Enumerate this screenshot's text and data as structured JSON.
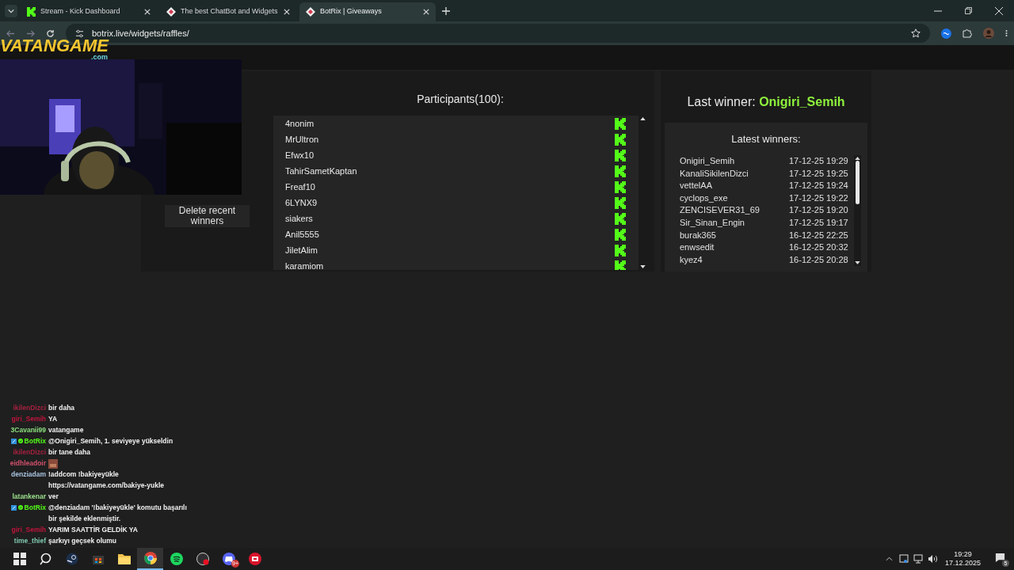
{
  "browser": {
    "tabs": [
      {
        "title": "Stream - Kick Dashboard",
        "kind": "kick",
        "selected": false
      },
      {
        "title": "The best ChatBot and Widgets",
        "kind": "botrix",
        "selected": false
      },
      {
        "title": "BotRix | Giveaways",
        "kind": "botrix",
        "selected": true
      }
    ],
    "address": "botrix.live/widgets/raffles/"
  },
  "overlay": {
    "logo": "VATANGAME",
    "logo_suffix": ".com"
  },
  "side_buttons": [
    "Delete recent winners"
  ],
  "participants": {
    "title": "Participants(100):",
    "names": [
      "4nonim",
      "MrUltron",
      "Efwx10",
      "TahirSametKaptan",
      "Freaf10",
      "6LYNX9",
      "siakers",
      "Anil5555",
      "JiletAlim",
      "karamiom"
    ]
  },
  "last_winner": {
    "label": "Last winner:",
    "name": "Onigiri_Semih"
  },
  "latest_winners": {
    "title": "Latest winners:",
    "rows": [
      {
        "name": "Onigiri_Semih",
        "time": "17-12-25 19:29"
      },
      {
        "name": "KanaliSikilenDizci",
        "time": "17-12-25 19:25"
      },
      {
        "name": "vettelAA",
        "time": "17-12-25 19:24"
      },
      {
        "name": "cyclops_exe",
        "time": "17-12-25 19:22"
      },
      {
        "name": "ZENCISEVER31_69",
        "time": "17-12-25 19:20"
      },
      {
        "name": "Sir_Sinan_Engin",
        "time": "17-12-25 19:17"
      },
      {
        "name": "burak365",
        "time": "16-12-25 22:25"
      },
      {
        "name": "enwsedit",
        "time": "16-12-25 20:32"
      },
      {
        "name": "kyez4",
        "time": "16-12-25 20:28"
      }
    ]
  },
  "chat": [
    {
      "kind": "user",
      "user": "ikilenDizci",
      "color": "#a3213f",
      "text": "bir daha"
    },
    {
      "kind": "user",
      "user": "giri_Semih",
      "color": "#c0143c",
      "text": "YA"
    },
    {
      "kind": "user",
      "user": "3Cavanii99",
      "color": "#8be07f",
      "text": "vatangame"
    },
    {
      "kind": "bot",
      "user": "BotRix",
      "color": "#53fc18",
      "text": "@Onigiri_Semih, 1. seviyeye yükseldin"
    },
    {
      "kind": "user",
      "user": "ikilenDizci",
      "color": "#a3213f",
      "text": "bir tane daha"
    },
    {
      "kind": "emote",
      "user": "eidhleadoir",
      "color": "#d2506c"
    },
    {
      "kind": "user",
      "user": "denziadam",
      "color": "#a9c4e0",
      "text": "!addcom !bakiyeyükle https://vatangame.com/bakiye-yukle"
    },
    {
      "kind": "user",
      "user": "latankenar",
      "color": "#9be08c",
      "text": "ver"
    },
    {
      "kind": "bot",
      "user": "BotRix",
      "color": "#53fc18",
      "text": "@denziadam '!bakiyeyükle' komutu başarılı bir şekilde eklenmiştir."
    },
    {
      "kind": "user",
      "user": "giri_Semih",
      "color": "#c0143c",
      "text": "YARIM SAATTİR GELDİK YA"
    },
    {
      "kind": "user",
      "user": "time_thief",
      "color": "#7fc9b0",
      "text": "şarkıyı geçsek olumu"
    }
  ],
  "taskbar": {
    "apps": [
      {
        "kind": "windows",
        "selected": false
      },
      {
        "kind": "search",
        "selected": false
      },
      {
        "kind": "steam",
        "selected": false
      },
      {
        "kind": "store",
        "selected": false
      },
      {
        "kind": "folder",
        "selected": false
      },
      {
        "kind": "chrome",
        "selected": true
      },
      {
        "kind": "spotify",
        "selected": false
      },
      {
        "kind": "obs",
        "selected": false
      },
      {
        "kind": "discord",
        "selected": false,
        "badge": "9+"
      },
      {
        "kind": "app",
        "selected": false
      }
    ],
    "time": "19:29",
    "date": "17.12.2025",
    "notifications": "5"
  }
}
